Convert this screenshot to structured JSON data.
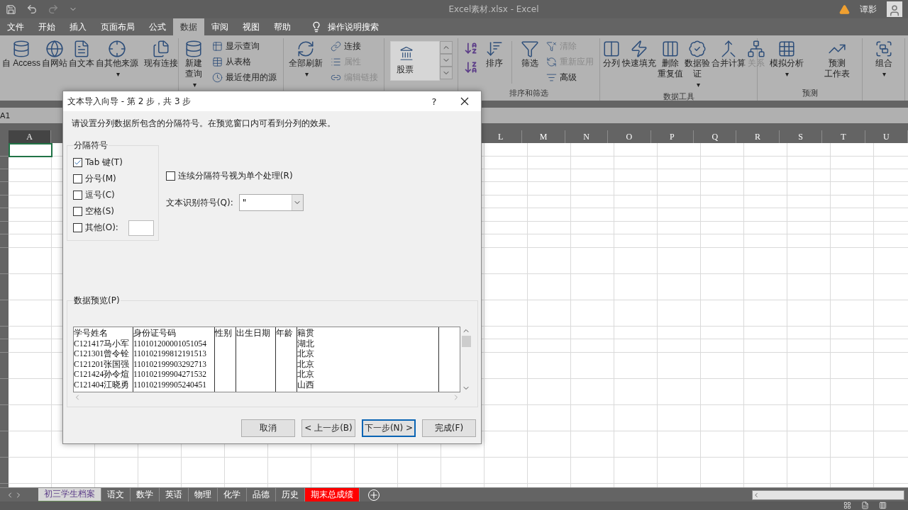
{
  "title_bar": {
    "title": "Excel素材.xlsx  -  Excel",
    "user": "谭影"
  },
  "ribbon_tabs": [
    {
      "label": "文件",
      "selected": false
    },
    {
      "label": "开始",
      "selected": false
    },
    {
      "label": "插入",
      "selected": false
    },
    {
      "label": "页面布局",
      "selected": false
    },
    {
      "label": "公式",
      "selected": false
    },
    {
      "label": "数据",
      "selected": true
    },
    {
      "label": "审阅",
      "selected": false
    },
    {
      "label": "视图",
      "selected": false
    },
    {
      "label": "帮助",
      "selected": false
    }
  ],
  "tell_me": "操作说明搜索",
  "ribbon_groups": [
    {
      "items": [
        {
          "kind": "large",
          "lines": [
            "自 Access"
          ],
          "disabled": false
        },
        {
          "kind": "large",
          "lines": [
            "自网站"
          ],
          "disabled": false
        },
        {
          "kind": "large",
          "lines": [
            "自文本"
          ],
          "disabled": false
        },
        {
          "kind": "large",
          "lines": [
            "自其他来源"
          ],
          "caret": "▾",
          "disabled": false
        },
        {
          "kind": "separator"
        },
        {
          "kind": "large",
          "lines": [
            "现有连接"
          ],
          "disabled": false
        }
      ]
    },
    {
      "items": [
        {
          "kind": "large",
          "lines": [
            "新建",
            "查询"
          ],
          "caret": "▾",
          "disabled": false
        },
        {
          "kind": "stack",
          "buttons": [
            {
              "label": "显示查询",
              "disabled": false
            },
            {
              "label": "从表格",
              "disabled": false
            },
            {
              "label": "最近使用的源",
              "disabled": false
            }
          ]
        }
      ]
    },
    {
      "items": [
        {
          "kind": "large",
          "lines": [
            "全部刷新"
          ],
          "caret": "▾",
          "disabled": false
        },
        {
          "kind": "stack",
          "buttons": [
            {
              "label": "连接",
              "disabled": false
            },
            {
              "label": "属性",
              "disabled": true
            },
            {
              "label": "编辑链接",
              "disabled": true
            }
          ]
        }
      ]
    },
    {
      "items": [
        {
          "kind": "gallery",
          "label": "股票"
        }
      ]
    },
    {
      "label": "排序和筛选",
      "items": [
        {
          "kind": "sort-pair"
        },
        {
          "kind": "large",
          "lines": [
            "排序"
          ],
          "disabled": false
        },
        {
          "kind": "separator"
        },
        {
          "kind": "large",
          "lines": [
            "筛选"
          ],
          "disabled": false
        },
        {
          "kind": "stack",
          "buttons": [
            {
              "label": "清除",
              "disabled": true
            },
            {
              "label": "重新应用",
              "disabled": true
            },
            {
              "label": "高级",
              "disabled": false
            }
          ]
        }
      ]
    },
    {
      "label": "数据工具",
      "items": [
        {
          "kind": "large",
          "lines": [
            "分列"
          ],
          "disabled": false
        },
        {
          "kind": "large",
          "lines": [
            "快速填充"
          ],
          "disabled": false
        },
        {
          "kind": "large",
          "lines": [
            "删除",
            "重复值"
          ],
          "disabled": false
        },
        {
          "kind": "large",
          "lines": [
            "数据验",
            "证"
          ],
          "caret": "▾",
          "disabled": false
        },
        {
          "kind": "large",
          "lines": [
            "合并计算"
          ],
          "disabled": false
        },
        {
          "kind": "large",
          "lines": [
            "关系"
          ],
          "disabled": true
        }
      ]
    },
    {
      "label": "预测",
      "items": [
        {
          "kind": "large",
          "lines": [
            "模拟分析"
          ],
          "caret": "▾",
          "disabled": false
        },
        {
          "kind": "large",
          "lines": [
            "预测",
            "工作表"
          ],
          "disabled": false
        }
      ]
    },
    {
      "items": [
        {
          "kind": "large",
          "lines": [
            "组合"
          ],
          "caret": "▾",
          "disabled": false
        }
      ]
    }
  ],
  "name_box": "A1",
  "columns": [
    {
      "label": "A"
    },
    {
      "label": "L"
    },
    {
      "label": "M"
    },
    {
      "label": "N"
    },
    {
      "label": "O"
    },
    {
      "label": "P"
    },
    {
      "label": "Q"
    },
    {
      "label": "R"
    },
    {
      "label": "S"
    },
    {
      "label": "T"
    },
    {
      "label": "U"
    }
  ],
  "sheet_tabs": [
    {
      "label": "初三学生档案",
      "selected": true
    },
    {
      "label": "语文",
      "selected": false
    },
    {
      "label": "数学",
      "selected": false
    },
    {
      "label": "英语",
      "selected": false
    },
    {
      "label": "物理",
      "selected": false
    },
    {
      "label": "化学",
      "selected": false
    },
    {
      "label": "品德",
      "selected": false
    },
    {
      "label": "历史",
      "selected": false
    },
    {
      "label": "期末总成绩",
      "selected": false,
      "color": "#ff0000"
    }
  ],
  "dialog": {
    "title": "文本导入向导 - 第 2 步，共 3 步",
    "help": "?",
    "instruction": "请设置分列数据所包含的分隔符号。在预览窗口内可看到分列的效果。",
    "delimiters_legend": "分隔符号",
    "delimiters": [
      {
        "label": "Tab 键(T)",
        "checked": true
      },
      {
        "label": "分号(M)",
        "checked": false
      },
      {
        "label": "逗号(C)",
        "checked": false
      },
      {
        "label": "空格(S)",
        "checked": false
      },
      {
        "label": "其他(O):",
        "checked": false,
        "kind": "other"
      }
    ],
    "consecutive": {
      "label": "连续分隔符号视为单个处理(R)",
      "checked": false
    },
    "qualifier": {
      "label": "文本识别符号(Q):",
      "value": "\""
    },
    "preview_legend": "数据预览(P)",
    "preview_columns": [
      {
        "lines": [
          "学号姓名",
          "C121417马小军",
          "C121301曾令铨",
          "C121201张国强",
          "C121424孙令煊",
          "C121404江晓勇"
        ]
      },
      {
        "lines": [
          "身份证号码",
          "110101200001051054",
          "110102199812191513",
          "110102199903292713",
          "110102199904271532",
          "110102199905240451"
        ]
      },
      {
        "lines": [
          "性别"
        ]
      },
      {
        "lines": [
          "出生日期"
        ]
      },
      {
        "lines": [
          "年龄"
        ]
      },
      {
        "lines": [
          "籍贯",
          "湖北",
          "北京",
          "北京",
          "北京",
          "山西"
        ]
      }
    ],
    "buttons": [
      {
        "label": "取消",
        "default": false
      },
      {
        "label": "< 上一步(B)",
        "default": false
      },
      {
        "label": "下一步(N) >",
        "default": true
      },
      {
        "label": "完成(F)",
        "default": false
      }
    ]
  }
}
